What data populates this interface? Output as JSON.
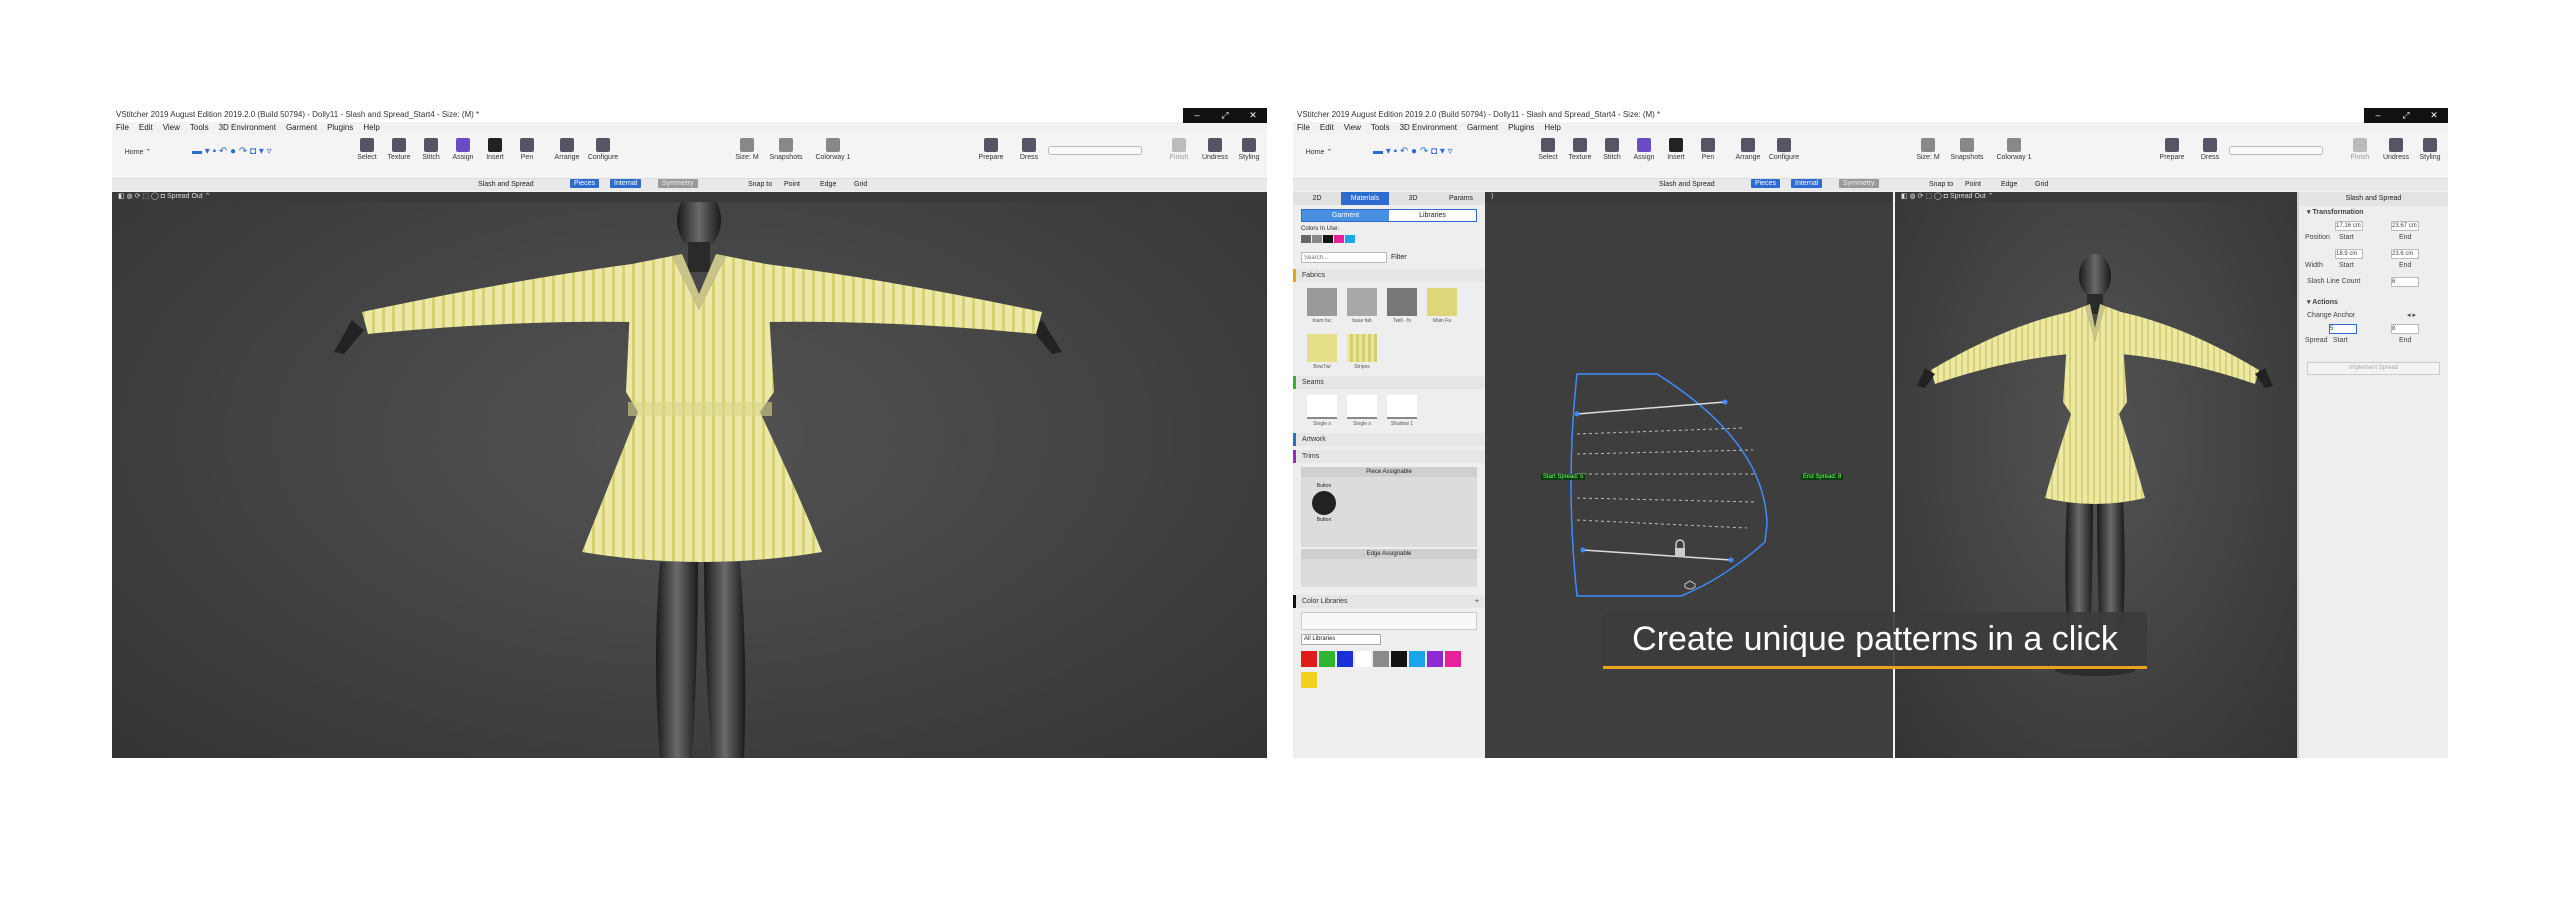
{
  "left_window": {
    "title": "VStitcher 2019 August Edition 2019.2.0 (Build 50794) - Dolly11 - Slash and Spread_Start4 - Size: (M) *",
    "window_buttons": [
      "–",
      "⤢",
      "✕"
    ],
    "menu": [
      "File",
      "Edit",
      "View",
      "Tools",
      "3D Environment",
      "Garment",
      "Plugins",
      "Help"
    ],
    "workspace": "Home",
    "tools": [
      "Select",
      "Texture",
      "Stitch",
      "Assign",
      "Insert",
      "Pen",
      "Arrange",
      "Configure"
    ],
    "size_controls": [
      "Size: M",
      "Snapshots",
      "Colorway 1"
    ],
    "right_tools": [
      "Prepare",
      "Dress"
    ],
    "right_tools2": [
      "Finish",
      "Undress",
      "Styling"
    ],
    "subbar": {
      "mode": "Slash and Spread",
      "pieces": "Pieces",
      "internal": "Internal",
      "symmetry": "Symmetry",
      "snap_to": "Snap to",
      "point": "Point",
      "edge": "Edge",
      "grid": "Grid"
    },
    "viewport_mode": "Spread Out"
  },
  "right_window": {
    "title": "VStitcher 2019 August Edition 2019.2.0 (Build 50794) - Dolly11 - Slash and Spread_Start4 - Size: (M) *",
    "menu": [
      "File",
      "Edit",
      "View",
      "Tools",
      "3D Environment",
      "Garment",
      "Plugins",
      "Help"
    ],
    "workspace": "Home",
    "tools": [
      "Select",
      "Texture",
      "Stitch",
      "Assign",
      "Insert",
      "Pen",
      "Arrange",
      "Configure"
    ],
    "size_controls": [
      "Size: M",
      "Snapshots",
      "Colorway 1"
    ],
    "right_tools": [
      "Prepare",
      "Dress"
    ],
    "right_tools2": [
      "Finish",
      "Undress",
      "Styling"
    ],
    "side_tabs": [
      "2D",
      "Materials",
      "3D",
      "Params"
    ],
    "sub_tabs": [
      "Garment",
      "Libraries"
    ],
    "colors_in_use": "Colors In Use:",
    "search_placeholder": "Search...",
    "filter": "Filter",
    "sections": {
      "fabrics": "Fabrics",
      "seams": "Seams",
      "artwork": "Artwork",
      "trims": "Trims",
      "color_libraries": "Color Libraries"
    },
    "fabric_items": [
      "Inam fac",
      "base fab",
      "Twill - fo",
      "Main Fa",
      "BowTwi",
      "Stripes"
    ],
    "seam_items": [
      "Single s",
      "Single s",
      "Shadow 1"
    ],
    "trims_headers": [
      "Piece Assignable",
      "Edge Assignable"
    ],
    "trim_item": "Button",
    "all_libraries": "All Libraries",
    "palette": [
      "#e01b1b",
      "#2fb52f",
      "#1a2fd6",
      "#ffffff",
      "#8a8a8a",
      "#111111",
      "#1aa6e8",
      "#8c2bd4",
      "#e8219b",
      "#f1d21a"
    ],
    "pattern_labels": {
      "start": "Start Spread: 5",
      "end": "End Spread: 8"
    },
    "viewport_mode": "Spread Out",
    "props": {
      "header": "Slash and Spread",
      "transformation": "Transformation",
      "position_label": "Position",
      "start_label": "Start",
      "end_label": "End",
      "pos_start": "17.16",
      "pos_end": "23.67",
      "width_label": "Width",
      "width_start": "18.9",
      "width_end": "23.6",
      "unit": "cm",
      "slash_count_label": "Slash Line Count",
      "slash_count": "6",
      "actions": "Actions",
      "change_anchor": "Change Anchor",
      "spread_label": "Spread",
      "spread_start": "5",
      "spread_end": "8",
      "implement": "Implement Spread"
    },
    "caption": "Create unique patterns in a click"
  },
  "colors": {
    "accent_blue": "#2e6bd1",
    "dress_yellow": "#e9e6a0",
    "caption_underline": "#e8a41a",
    "pattern_line": "#3f8cff"
  }
}
